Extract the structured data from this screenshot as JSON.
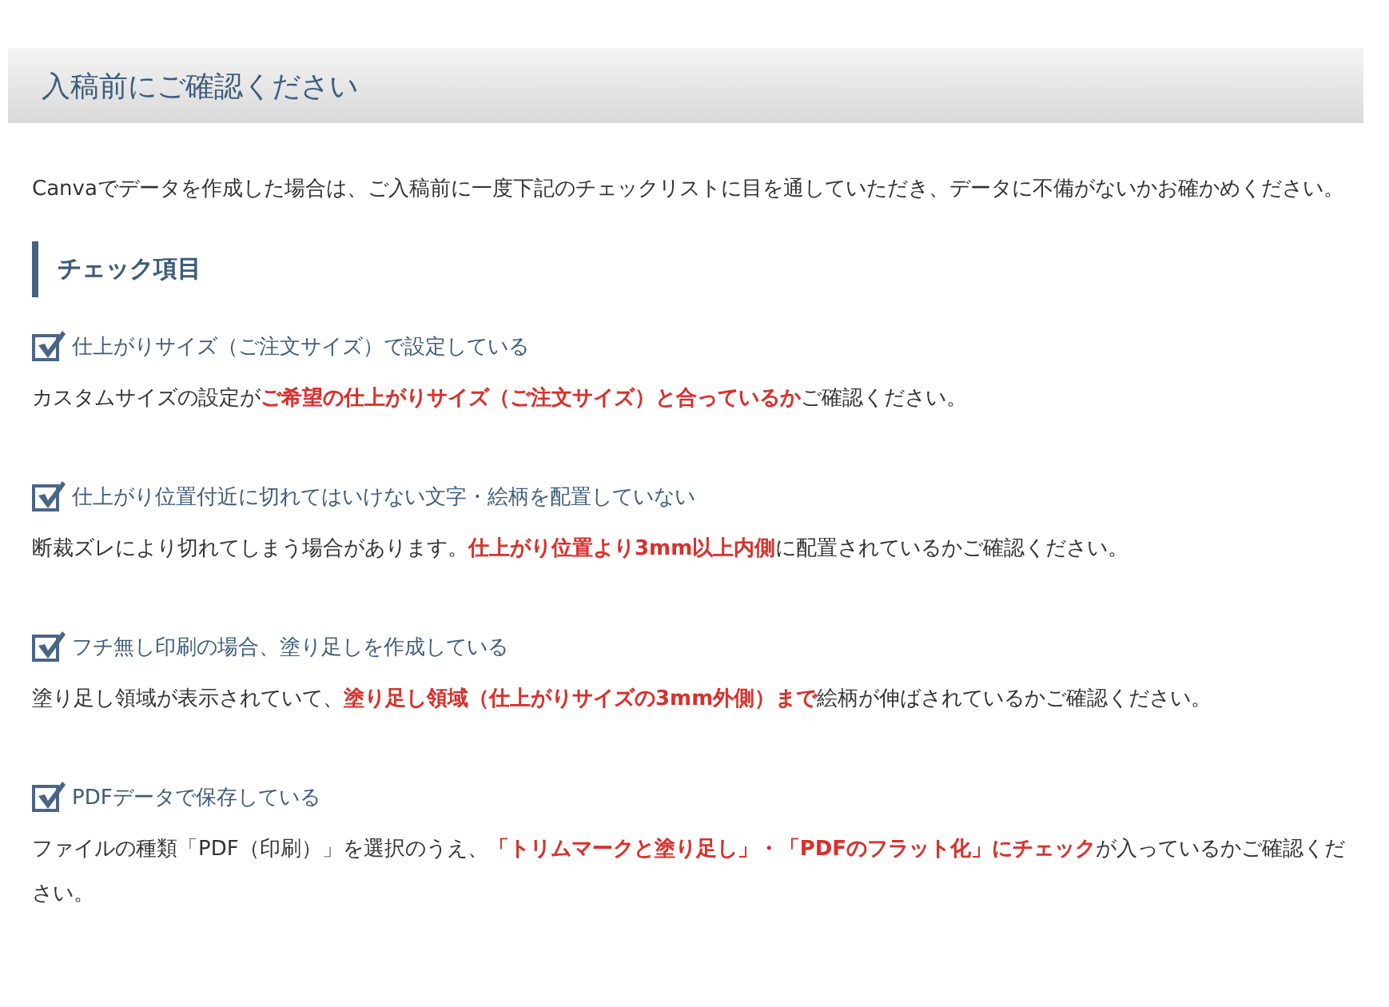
{
  "header": {
    "title": "入稿前にご確認ください"
  },
  "intro": "Canvaでデータを作成した場合は、ご入稿前に一度下記のチェックリストに目を通していただき、データに不備がないかお確かめください。",
  "section": {
    "title": "チェック項目"
  },
  "items": [
    {
      "title": "仕上がりサイズ（ご注文サイズ）で設定している",
      "checked": true,
      "description": "カスタムサイズの設定が**ご希望の仕上がりサイズ（ご注文サイズ）と合っているか**ご確認ください。"
    },
    {
      "title": "仕上がり位置付近に切れてはいけない文字・絵柄を配置していない",
      "checked": true,
      "description": "断裁ズレにより切れてしまう場合があります。**仕上がり位置より3mm以上内側**に配置されているかご確認ください。"
    },
    {
      "title": "フチ無し印刷の場合、塗り足しを作成している",
      "checked": true,
      "description": "塗り足し領域が表示されていて、**塗り足し領域（仕上がりサイズの3mm外側）まで**絵柄が伸ばされているかご確認ください。"
    },
    {
      "title": "PDFデータで保存している",
      "checked": true,
      "description": "ファイルの種類「PDF（印刷）」を選択のうえ、**「トリムマークと塗り足し」・「PDFのフラット化」にチェック**が入っているかご確認ください。"
    }
  ]
}
